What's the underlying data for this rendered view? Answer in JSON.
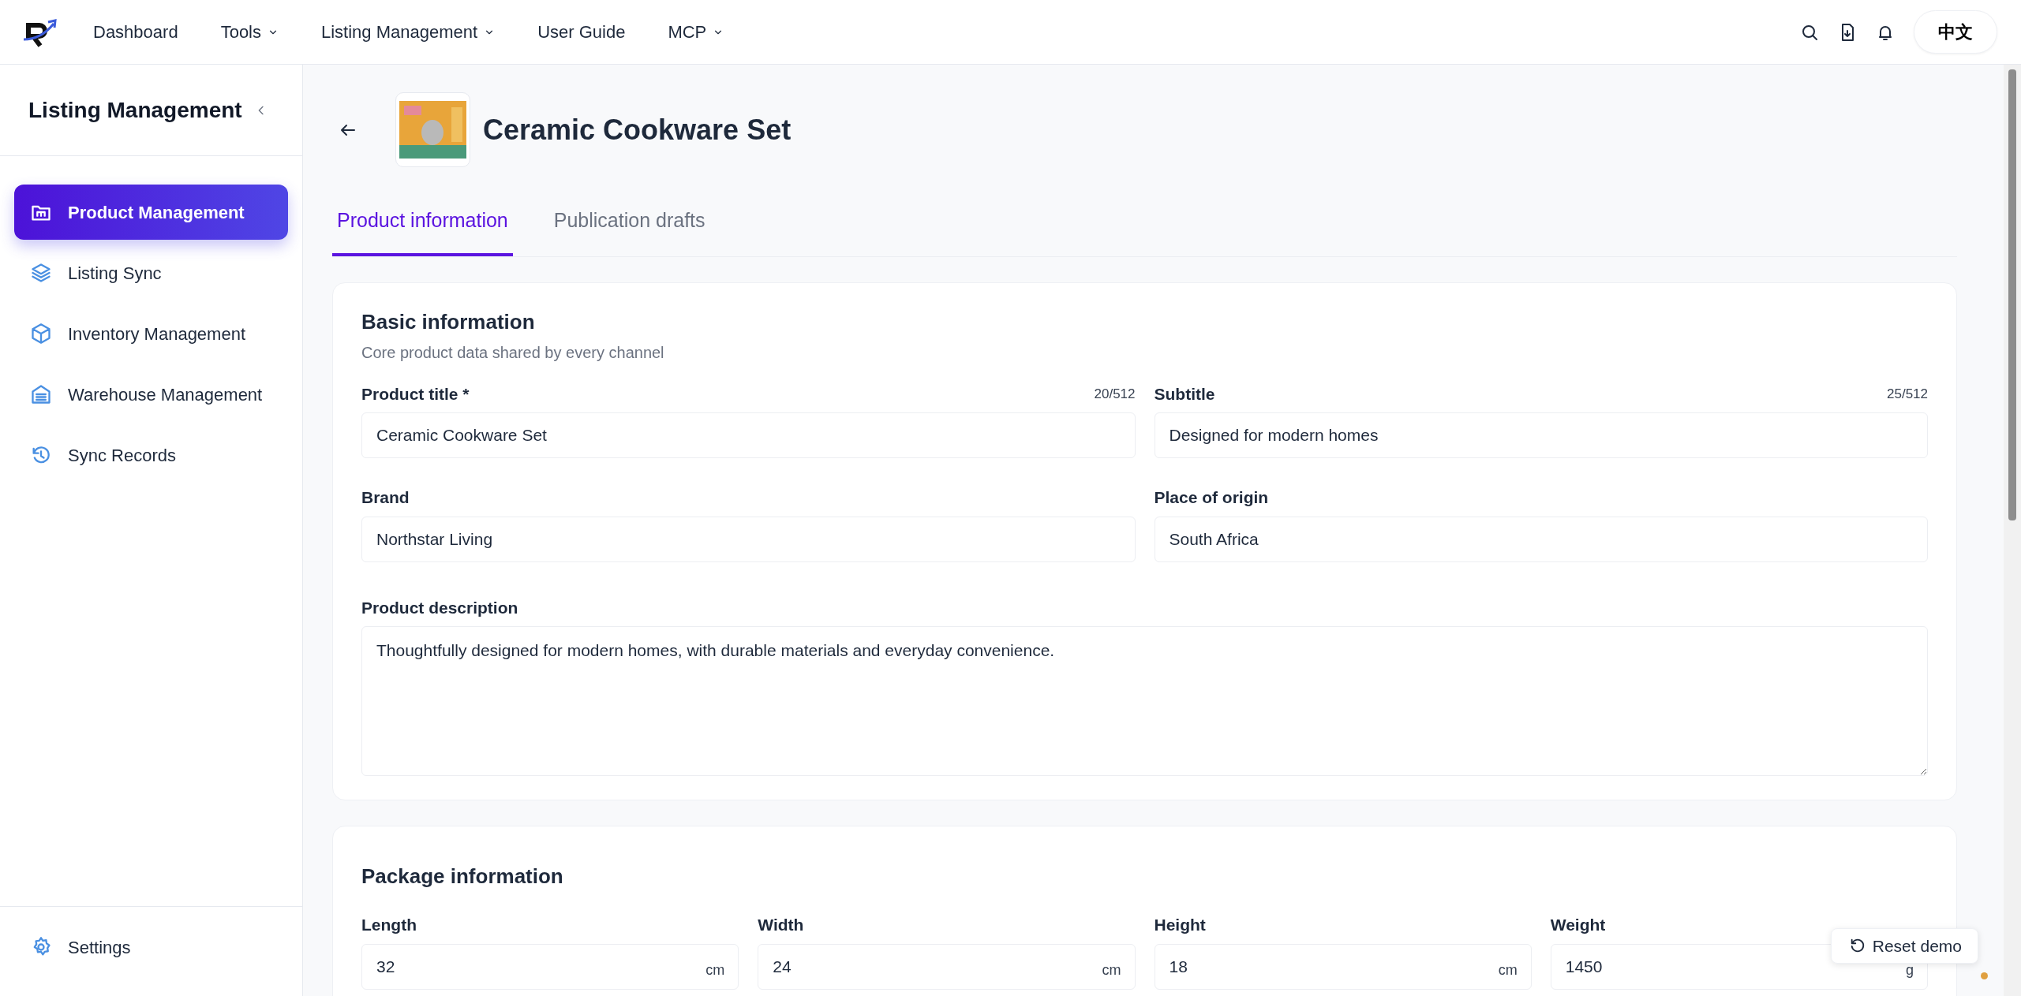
{
  "nav": {
    "items": [
      {
        "label": "Dashboard",
        "dropdown": false
      },
      {
        "label": "Tools",
        "dropdown": true
      },
      {
        "label": "Listing Management",
        "dropdown": true
      },
      {
        "label": "User Guide",
        "dropdown": false
      },
      {
        "label": "MCP",
        "dropdown": true
      }
    ],
    "language": "中文"
  },
  "sidebar": {
    "title": "Listing Management",
    "items": [
      {
        "label": "Product Management",
        "selected": true
      },
      {
        "label": "Listing Sync",
        "selected": false
      },
      {
        "label": "Inventory Management",
        "selected": false
      },
      {
        "label": "Warehouse Management",
        "selected": false
      },
      {
        "label": "Sync Records",
        "selected": false
      }
    ],
    "footer": "Settings"
  },
  "page": {
    "title": "Ceramic Cookware Set",
    "tabs": [
      {
        "label": "Product information",
        "selected": true
      },
      {
        "label": "Publication drafts",
        "selected": false
      }
    ]
  },
  "basic_info": {
    "title": "Basic information",
    "subtitle": "Core product data shared by every channel",
    "fields": [
      {
        "kind": "input",
        "label": "Product title *",
        "counter": "20/512",
        "value": "Ceramic Cookware Set"
      },
      {
        "kind": "input",
        "label": "Subtitle",
        "counter": "25/512",
        "value": "Designed for modern homes"
      },
      {
        "kind": "input",
        "label": "Brand",
        "value": "Northstar Living"
      },
      {
        "kind": "input",
        "label": "Place of origin",
        "value": "South Africa"
      },
      {
        "kind": "textarea",
        "label": "Product description",
        "value": "Thoughtfully designed for modern homes, with durable materials and everyday convenience."
      }
    ]
  },
  "package_info": {
    "title": "Package information",
    "fields": [
      {
        "label": "Length",
        "value": "32",
        "unit": "cm"
      },
      {
        "label": "Width",
        "value": "24",
        "unit": "cm"
      },
      {
        "label": "Height",
        "value": "18",
        "unit": "cm"
      },
      {
        "label": "Weight",
        "value": "1450",
        "unit": "g"
      }
    ]
  },
  "reset_button": "Reset demo"
}
